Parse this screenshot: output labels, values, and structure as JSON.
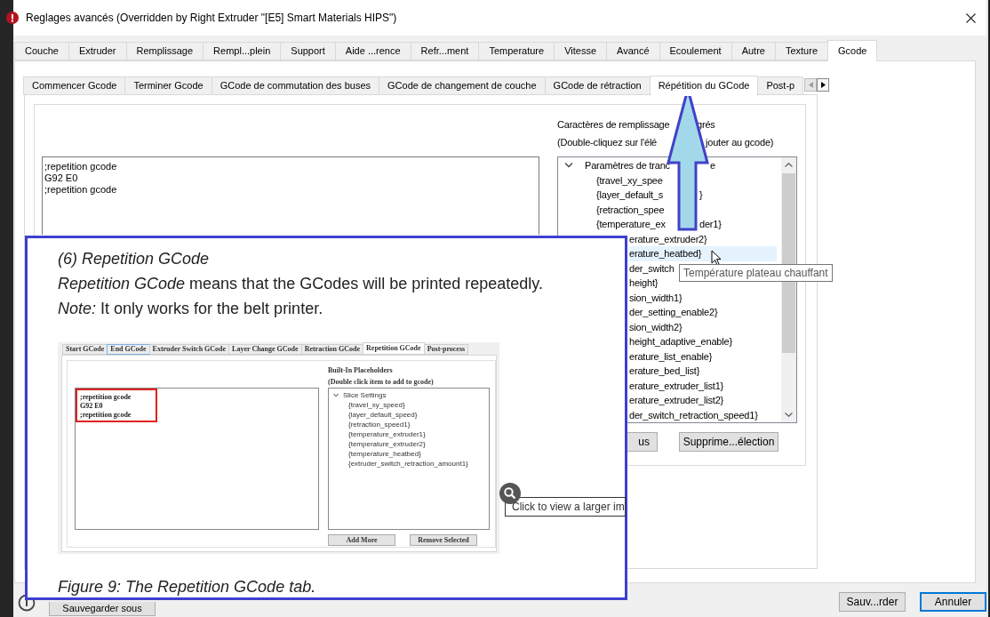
{
  "window": {
    "title": "Reglages avancés (Overridden by Right Extruder \"[E5] Smart Materials HIPS\")"
  },
  "main_tabs": [
    {
      "label": "Couche",
      "selected": false
    },
    {
      "label": "Extruder",
      "selected": false
    },
    {
      "label": "Remplissage",
      "selected": false
    },
    {
      "label": "Rempl...plein",
      "selected": false
    },
    {
      "label": "Support",
      "selected": false
    },
    {
      "label": "Aide ...rence",
      "selected": false
    },
    {
      "label": "Refr...ment",
      "selected": false
    },
    {
      "label": "Temperature",
      "selected": false
    },
    {
      "label": "Vitesse",
      "selected": false
    },
    {
      "label": "Avancé",
      "selected": false
    },
    {
      "label": "Ecoulement",
      "selected": false
    },
    {
      "label": "Autre",
      "selected": false
    },
    {
      "label": "Texture",
      "selected": false
    },
    {
      "label": "Gcode",
      "selected": true
    }
  ],
  "sub_tabs": [
    {
      "label": "Commencer Gcode",
      "selected": false
    },
    {
      "label": "Terminer Gcode",
      "selected": false
    },
    {
      "label": "GCode de commutation des buses",
      "selected": false
    },
    {
      "label": "GCode de changement de couche",
      "selected": false
    },
    {
      "label": "GCode de rétraction",
      "selected": false
    },
    {
      "label": "Répétition du GCode",
      "selected": true
    },
    {
      "label": "Post-p",
      "selected": false
    }
  ],
  "gcode_editor": {
    "lines": [
      ";repetition gcode",
      "G92 E0",
      ";repetition gcode"
    ]
  },
  "placeholders": {
    "captions": [
      {
        "text": "Caractères de remplissage",
        "text_after": "grés"
      },
      {
        "text": "(Double-cliquez sur l'élé",
        "text_after": "jouter au gcode)"
      }
    ],
    "tree": {
      "label": "Paramètres de tranc",
      "label_after": "e",
      "expanded": true,
      "children": [
        {
          "kind": "whole",
          "text": "{travel_xy_spee",
          "selected": false
        },
        {
          "kind": "whole",
          "text": "{layer_default_s",
          "text_after": "}",
          "selected": false
        },
        {
          "kind": "whole",
          "text": "{retraction_spee",
          "selected": false
        },
        {
          "kind": "whole",
          "text": "{temperature_ex",
          "text_after": "der1}",
          "selected": false
        },
        {
          "kind": "cut",
          "text": "erature_extruder2}",
          "selected": false
        },
        {
          "kind": "cut",
          "text": "erature_heatbed}",
          "selected": true
        },
        {
          "kind": "cut",
          "text": "der_switch",
          "selected": false
        },
        {
          "kind": "cut",
          "text": "height}",
          "selected": false
        },
        {
          "kind": "cut",
          "text": "sion_width1}",
          "selected": false
        },
        {
          "kind": "cut",
          "text": "der_setting_enable2}",
          "selected": false
        },
        {
          "kind": "cut",
          "text": "sion_width2}",
          "selected": false
        },
        {
          "kind": "cut",
          "text": "height_adaptive_enable}",
          "selected": false
        },
        {
          "kind": "cut",
          "text": "erature_list_enable}",
          "selected": false
        },
        {
          "kind": "cut",
          "text": "erature_bed_list}",
          "selected": false
        },
        {
          "kind": "cut",
          "text": "erature_extruder_list1}",
          "selected": false
        },
        {
          "kind": "cut",
          "text": "erature_extruder_list2}",
          "selected": false
        },
        {
          "kind": "cut",
          "text": "der_switch_retraction_speed1}",
          "selected": false
        }
      ]
    },
    "buttons": [
      "us",
      "Supprime...élection"
    ]
  },
  "tooltip": "Température plateau chauffant",
  "footer": {
    "save_as": "Sauvegarder sous",
    "buttons": [
      {
        "label": "Sauv...rder",
        "focused": false
      },
      {
        "label": "Annuler",
        "focused": true
      }
    ]
  },
  "figure": {
    "heading": "(6) Repetition GCode",
    "lines": [
      "*Repetition GCode* means that the GCodes will be printed repeatedly.",
      "*Note:* It only works for the belt printer."
    ],
    "screenshot": {
      "tabs": [
        {
          "label": "Start GCode",
          "selected": false,
          "highlighted": false
        },
        {
          "label": "End GCode",
          "selected": false,
          "highlighted": true
        },
        {
          "label": "Extruder Switch GCode",
          "selected": false,
          "highlighted": false
        },
        {
          "label": "Layer Change GCode",
          "selected": false,
          "highlighted": false
        },
        {
          "label": "Retraction GCode",
          "selected": false,
          "highlighted": false
        },
        {
          "label": "Repetition GCode",
          "selected": true,
          "highlighted": false
        },
        {
          "label": "Post-process",
          "selected": false,
          "highlighted": false
        }
      ],
      "code_lines": [
        ";repetition gcode",
        "G92 E0",
        ";repetition gcode"
      ],
      "title": "Built-In Placeholders",
      "hint": "(Double click item to add to gcode)",
      "tree_label": "Slice Settings",
      "items": [
        "{travel_xy_speed}",
        "{layer_default_speed}",
        "{retraction_speed1}",
        "{temperature_extruder1}",
        "{temperature_extruder2}",
        "{temperature_heatbed}",
        "{extruder_switch_retraction_amount1}"
      ],
      "buttons": [
        "Add More",
        "Remove Selected"
      ]
    },
    "caption": "Figure 9: The Repetition GCode tab.",
    "zoom_hint": "Click to view a larger im"
  }
}
